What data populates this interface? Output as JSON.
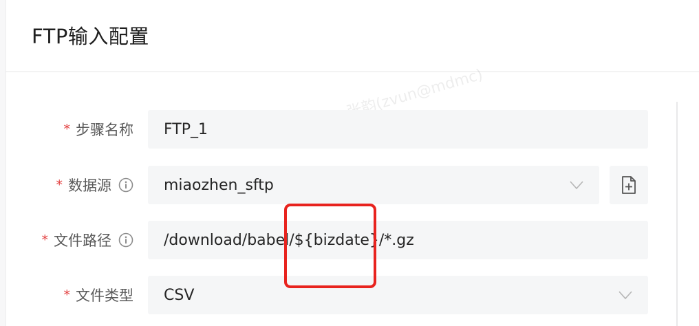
{
  "dialog": {
    "title": "FTP输入配置"
  },
  "watermark": "张韵(zvun@mdmc)",
  "form": {
    "required_mark": "*",
    "step_name": {
      "label": "步骤名称",
      "value": "FTP_1"
    },
    "data_source": {
      "label": "数据源",
      "value": "miaozhen_sftp",
      "icon": "info-circle-icon",
      "add_icon": "add-file-icon"
    },
    "file_path": {
      "label": "文件路径",
      "value": "/download/babel/${bizdate}/*.gz",
      "icon": "info-circle-icon"
    },
    "file_type": {
      "label": "文件类型",
      "value": "CSV"
    }
  },
  "colors": {
    "required": "#e23c3c",
    "highlight": "#e8231e",
    "field_bg": "#f5f6f7"
  }
}
